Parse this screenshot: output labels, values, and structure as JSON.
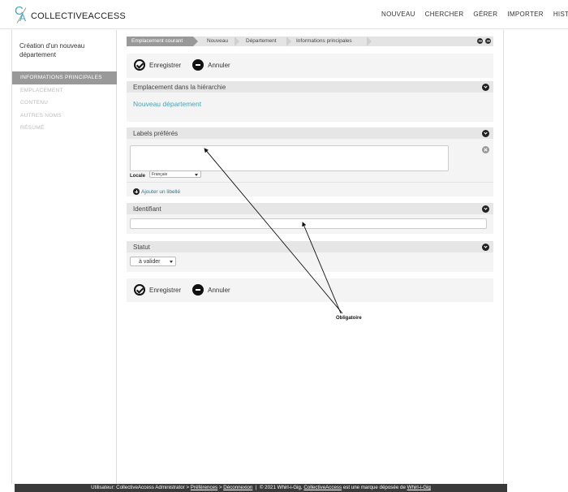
{
  "header": {
    "logo_text": "COLLECTIVEACCESS",
    "logo_mark_c": "C",
    "logo_mark_a": "A",
    "nav": [
      "NOUVEAU",
      "CHERCHER",
      "GÉRER",
      "IMPORTER",
      "HISTORI"
    ]
  },
  "sidebar": {
    "title": "Création d'un nouveau département",
    "items": [
      {
        "label": "INFORMATIONS PRINCIPALES",
        "active": true
      },
      {
        "label": "EMPLACEMENT",
        "active": false
      },
      {
        "label": "CONTENU",
        "active": false
      },
      {
        "label": "AUTRES NOMS",
        "active": false
      },
      {
        "label": "RÉSUMÉ",
        "active": false
      }
    ]
  },
  "breadcrumb": [
    "Emplacement courant",
    "Nouveau",
    "Département",
    "Informations principales"
  ],
  "actions": {
    "save_label": "Enregistrer",
    "cancel_label": "Annuler"
  },
  "hierarchy": {
    "title": "Emplacement dans la hiérarchie",
    "value": "Nouveau département"
  },
  "labels": {
    "title": "Labels préférés",
    "textarea_value": "",
    "locale_label": "Locale",
    "locale_value": "Français",
    "add_label": "Ajouter un libellé"
  },
  "identifier": {
    "title": "Identifiant",
    "value": ""
  },
  "status": {
    "title": "Statut",
    "value": "à valider"
  },
  "annotation": {
    "text": "Obligatoire"
  },
  "footer": {
    "user_prefix": "Utilisateur: CollectiveAccess Administrator >",
    "preferences": "Préférences",
    "sep1": ">",
    "logout": "Déconnexion",
    "sep2": "|",
    "copyright_prefix": "© 2021 Whirl-i-Gig,",
    "ca_link": "CollectiveAccess",
    "trademark_text": "est une marque déposée de",
    "wig_link": "Whirl-i-Gig"
  }
}
